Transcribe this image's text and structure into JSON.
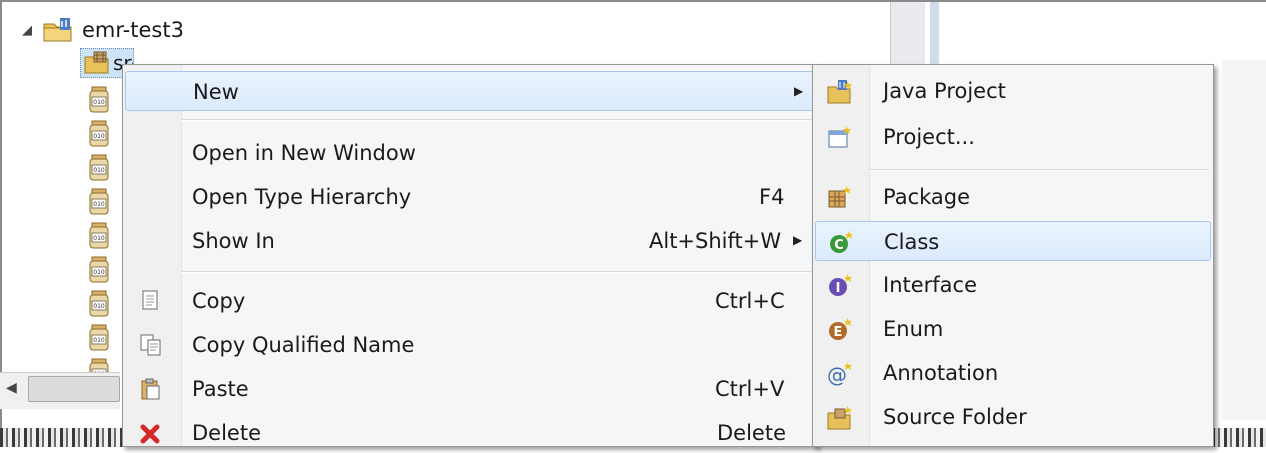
{
  "explorer": {
    "project": {
      "name": "emr-test3",
      "arrow": "◢"
    },
    "src": {
      "label": "src"
    },
    "jar_count": 9,
    "scroll_left_arrow": "◀"
  },
  "context_menu": {
    "items": [
      {
        "label": "New",
        "accel": "",
        "submenu": true,
        "highlighted": true,
        "icon": ""
      },
      {
        "label": "Open in New Window",
        "accel": "",
        "icon": ""
      },
      {
        "label": "Open Type Hierarchy",
        "accel": "F4",
        "icon": ""
      },
      {
        "label": "Show In",
        "accel": "Alt+Shift+W",
        "submenu": true,
        "icon": ""
      },
      {
        "label": "Copy",
        "accel": "Ctrl+C",
        "icon": "copy-icon"
      },
      {
        "label": "Copy Qualified Name",
        "accel": "",
        "icon": "copy-qualified-name-icon"
      },
      {
        "label": "Paste",
        "accel": "Ctrl+V",
        "icon": "paste-icon"
      },
      {
        "label": "Delete",
        "accel": "Delete",
        "icon": "delete-icon"
      }
    ],
    "submenu_arrow": "▶"
  },
  "new_submenu": {
    "items": [
      {
        "label": "Java Project",
        "icon": "java-project-icon"
      },
      {
        "label": "Project...",
        "icon": "project-icon"
      },
      {
        "label": "Package",
        "icon": "package-icon"
      },
      {
        "label": "Class",
        "icon": "class-icon",
        "highlighted": true
      },
      {
        "label": "Interface",
        "icon": "interface-icon"
      },
      {
        "label": "Enum",
        "icon": "enum-icon"
      },
      {
        "label": "Annotation",
        "icon": "annotation-icon"
      },
      {
        "label": "Source Folder",
        "icon": "source-folder-icon"
      }
    ]
  },
  "colors": {
    "highlight_bg": "#dbeafd",
    "highlight_border": "#a7c8ee",
    "class_icon": "#3a9a3a",
    "interface_icon": "#6a4fb3",
    "enum_icon": "#b06a2a",
    "delete_icon": "#d42a2a"
  }
}
